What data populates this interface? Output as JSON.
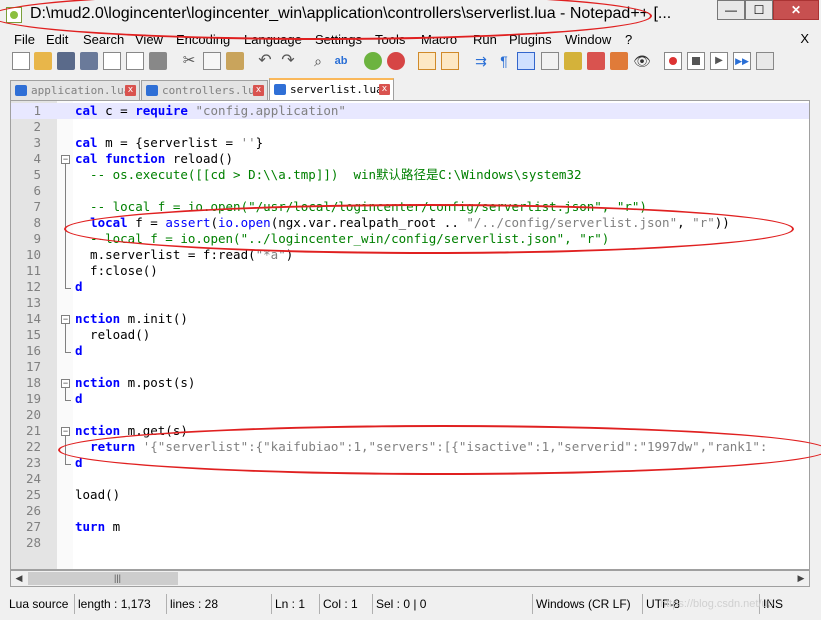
{
  "window": {
    "title": "D:\\mud2.0\\logincenter\\logincenter_win\\application\\controllers\\serverlist.lua - Notepad++ [...",
    "controls": {
      "minimize": "—",
      "maximize": "☐",
      "close": "✕"
    }
  },
  "menu": {
    "items": [
      "File",
      "Edit",
      "Search",
      "View",
      "Encoding",
      "Language",
      "Settings",
      "Tools",
      "Macro",
      "Run",
      "Plugins",
      "Window",
      "?"
    ],
    "close": "X"
  },
  "tabs": [
    {
      "label": "application.lua",
      "active": false
    },
    {
      "label": "controllers.lua",
      "active": false
    },
    {
      "label": "serverlist.lua",
      "active": true
    }
  ],
  "tab_close": "x",
  "lines": {
    "l1": {
      "num": "1",
      "p1": "cal",
      "p2": " c = ",
      "p3": "require",
      "p4": " ",
      "p5": "\"config.application\""
    },
    "l2": {
      "num": "2"
    },
    "l3": {
      "num": "3",
      "p1": "cal",
      "p2": " m = {serverlist = ",
      "p3": "''",
      "p4": "}"
    },
    "l4": {
      "num": "4",
      "p1": "cal",
      "p2": " ",
      "p3": "function",
      "p4": " reload()"
    },
    "l5": {
      "num": "5",
      "p1": "  -- os.execute([[cd > D:\\\\a.tmp]])  win默认路径是C:\\Windows\\system32"
    },
    "l6": {
      "num": "6"
    },
    "l7": {
      "num": "7",
      "p1": "  -- local f = io.open(\"/usr/local/logincenter/config/serverlist.json\", \"r\")"
    },
    "l8": {
      "num": "8",
      "p1": "  ",
      "p2": "local",
      "p3": " f = ",
      "p4": "assert",
      "p5": "(",
      "p6": "io.open",
      "p7": "(ngx.var.realpath_root .. ",
      "p8": "\"/../config/serverlist.json\"",
      "p9": ", ",
      "p10": "\"r\"",
      "p11": "))"
    },
    "l9": {
      "num": "9",
      "p1": "  --local f = io.open(\"../logincenter_win/config/serverlist.json\", \"r\")"
    },
    "l10": {
      "num": "10",
      "p1": "  m.serverlist = f:read(",
      "p2": "\"*a\"",
      "p3": ")"
    },
    "l11": {
      "num": "11",
      "p1": "  f:close()"
    },
    "l12": {
      "num": "12",
      "p1": "d"
    },
    "l13": {
      "num": "13"
    },
    "l14": {
      "num": "14",
      "p1": "nction",
      "p2": " m.init()"
    },
    "l15": {
      "num": "15",
      "p1": "  reload()"
    },
    "l16": {
      "num": "16",
      "p1": "d"
    },
    "l17": {
      "num": "17"
    },
    "l18": {
      "num": "18",
      "p1": "nction",
      "p2": " m.post(s)"
    },
    "l19": {
      "num": "19",
      "p1": "d"
    },
    "l20": {
      "num": "20"
    },
    "l21": {
      "num": "21",
      "p1": "nction",
      "p2": " m.get(s)"
    },
    "l22": {
      "num": "22",
      "p1": "  ",
      "p2": "return",
      "p3": " ",
      "p4": "'{\"serverlist\":{\"kaifubiao\":1,\"servers\":[{\"isactive\":1,\"serverid\":\"1997dw\",\"rank1\":"
    },
    "l23": {
      "num": "23",
      "p1": "d"
    },
    "l24": {
      "num": "24"
    },
    "l25": {
      "num": "25",
      "p1": "load()"
    },
    "l26": {
      "num": "26"
    },
    "l27": {
      "num": "27",
      "p1": "turn",
      "p2": " m"
    },
    "l28": {
      "num": "28"
    }
  },
  "status": {
    "lang": "Lua source",
    "length": "length : 1,173",
    "lines": "lines : 28",
    "ln": "Ln : 1",
    "col": "Col : 1",
    "sel": "Sel : 0 | 0",
    "eol": "Windows (CR LF)",
    "enc": "UTF-8",
    "mode": "INS"
  },
  "watermark": "https://blog.csdn.net/u0",
  "colors": {
    "annotation": "#e02020",
    "keyword": "#0000ff",
    "comment": "#008000",
    "string": "#808080",
    "current_line": "#e8e8ff"
  }
}
